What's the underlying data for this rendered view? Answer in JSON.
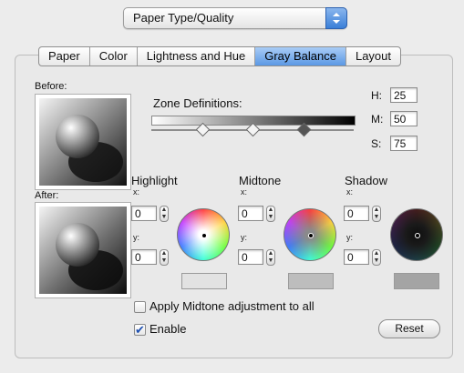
{
  "popup": {
    "selected": "Paper Type/Quality"
  },
  "tabs": [
    {
      "label": "Paper"
    },
    {
      "label": "Color"
    },
    {
      "label": "Lightness and Hue"
    },
    {
      "label": "Gray Balance",
      "active": true
    },
    {
      "label": "Layout"
    }
  ],
  "preview": {
    "before_label": "Before:",
    "after_label": "After:"
  },
  "zone": {
    "label": "Zone Definitions:",
    "handles": [
      0.25,
      0.5,
      0.75
    ]
  },
  "hms": [
    {
      "label": "H:",
      "value": "25"
    },
    {
      "label": "M:",
      "value": "50"
    },
    {
      "label": "S:",
      "value": "75"
    }
  ],
  "balance": [
    {
      "title": "Highlight",
      "x_label": "x:",
      "x_value": "0",
      "y_label": "y:",
      "y_value": "0",
      "swatch_color": "#e2e2e2",
      "wheel_tone": "#ffffff"
    },
    {
      "title": "Midtone",
      "x_label": "x:",
      "x_value": "0",
      "y_label": "y:",
      "y_value": "0",
      "swatch_color": "#bdbdbd",
      "wheel_tone": "#8a8a8a"
    },
    {
      "title": "Shadow",
      "x_label": "x:",
      "x_value": "0",
      "y_label": "y:",
      "y_value": "0",
      "swatch_color": "#a4a4a4",
      "wheel_tone": "#1a1a1a"
    }
  ],
  "options": {
    "apply_midtone_label": "Apply Midtone adjustment to all",
    "apply_midtone_checked": false,
    "enable_label": "Enable",
    "enable_checked": true
  },
  "reset_label": "Reset",
  "icons": {
    "popup_arrows": "updown-arrows-icon",
    "stepper": "stepper-arrows-icon",
    "check": "checkmark-icon"
  }
}
